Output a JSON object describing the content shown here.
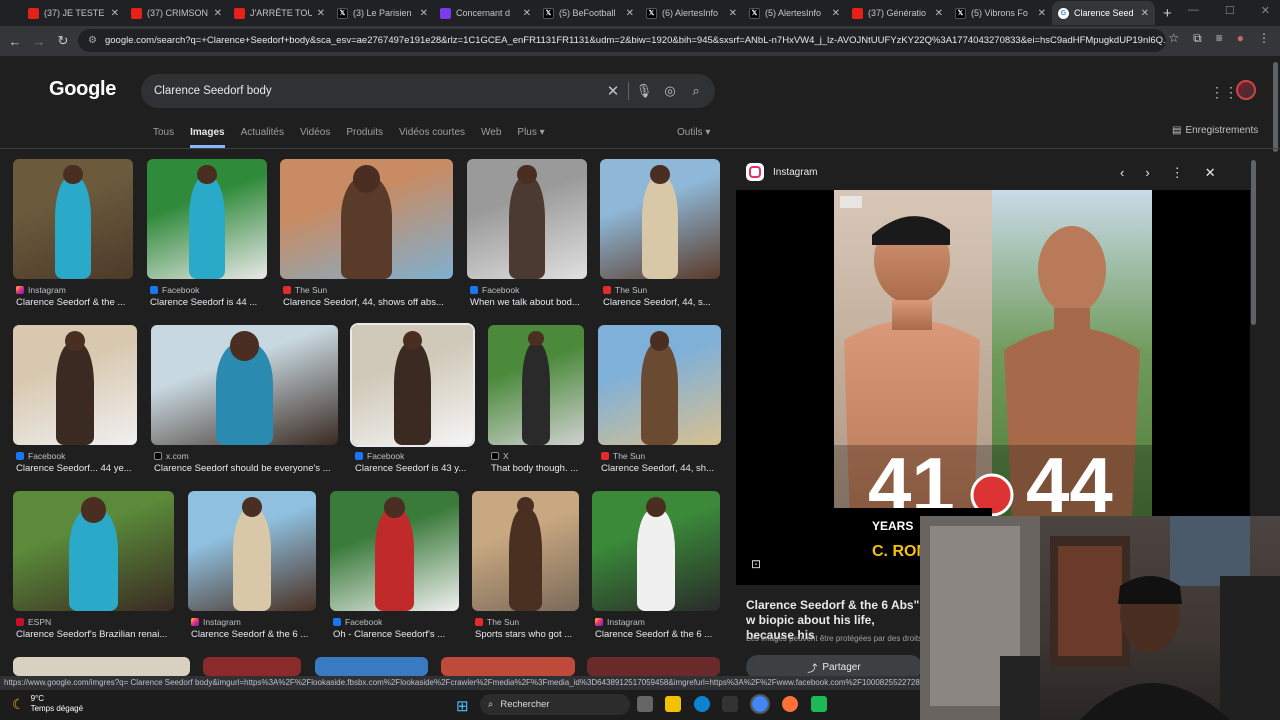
{
  "tabs": [
    {
      "label": "(37) JE TESTE L",
      "fav": "yt"
    },
    {
      "label": "(37) CRIMSON",
      "fav": "yt"
    },
    {
      "label": "J'ARRÊTE TOUT",
      "fav": "yt"
    },
    {
      "label": "(3) Le Parisien",
      "fav": "xx"
    },
    {
      "label": "Concernant d",
      "fav": "tw"
    },
    {
      "label": "(5) BeFootball",
      "fav": "xx"
    },
    {
      "label": "(6) AlertesInfo",
      "fav": "xx"
    },
    {
      "label": "(5) AlertesInfo",
      "fav": "xx"
    },
    {
      "label": "(37) Génératio",
      "fav": "yt"
    },
    {
      "label": "(5) Vibrons Fo",
      "fav": "xx"
    },
    {
      "label": "Clarence Seed",
      "fav": "gg",
      "active": true
    }
  ],
  "address": {
    "url": "google.com/search?q=+Clarence+Seedorf+body&sca_esv=ae2767497e191e28&rlz=1C1GCEA_enFR1131FR1131&udm=2&biw=1920&bih=945&sxsrf=ANbL-n7HxVW4_j_lz-AVOJNtUUFYzKY22Q%3A1774043270833&ei=hsC9adHFMpugkdUP19nl6Q..."
  },
  "google": {
    "logo": "Google",
    "query": "Clarence Seedorf body",
    "filters": [
      "Tous",
      "Images",
      "Actualités",
      "Vidéos",
      "Produits",
      "Vidéos courtes",
      "Web",
      "Plus ▾"
    ],
    "tools": "Outils ▾",
    "saved": "Enregistrements"
  },
  "results": [
    {
      "source": "Instagram",
      "src_type": "ig",
      "caption": "Clarence Seedorf & the ..."
    },
    {
      "source": "Facebook",
      "src_type": "fb",
      "caption": "Clarence Seedorf is 44 ..."
    },
    {
      "source": "The Sun",
      "src_type": "sun",
      "caption": "Clarence Seedorf, 44, shows off abs..."
    },
    {
      "source": "Facebook",
      "src_type": "fb",
      "caption": "When we talk about bod..."
    },
    {
      "source": "The Sun",
      "src_type": "sun",
      "caption": "Clarence Seedorf, 44, s..."
    },
    {
      "source": "Facebook",
      "src_type": "fb",
      "caption": "Clarence Seedorf... 44 ye..."
    },
    {
      "source": "x.com",
      "src_type": "xc",
      "caption": "Clarence Seedorf should be everyone's ..."
    },
    {
      "source": "Facebook",
      "src_type": "fb",
      "caption": "Clarence Seedorf is 43 y..."
    },
    {
      "source": "X",
      "src_type": "xc",
      "caption": "That body though. ..."
    },
    {
      "source": "The Sun",
      "src_type": "sun",
      "caption": "Clarence Seedorf, 44, sh..."
    },
    {
      "source": "ESPN",
      "src_type": "es",
      "caption": "Clarence Seedorf's Brazilian renai..."
    },
    {
      "source": "Instagram",
      "src_type": "ig",
      "caption": "Clarence Seedorf & the 6 ..."
    },
    {
      "source": "Facebook",
      "src_type": "fb",
      "caption": "Oh - Clarence Seedorf's ..."
    },
    {
      "source": "The Sun",
      "src_type": "sun",
      "caption": "Sports stars who got ..."
    },
    {
      "source": "Instagram",
      "src_type": "ig",
      "caption": "Clarence Seedorf & the 6 ..."
    }
  ],
  "preview": {
    "source": "Instagram",
    "title": "Clarence Seedorf & the 6 Abs\" w biopic about his life, because his",
    "note": "Les images peuvent être protégées par des droits",
    "share": "Partager",
    "age_left": "41",
    "age_right": "44",
    "years": "YEARS",
    "name_tag": "C. RONA"
  },
  "status_url": "https://www.google.com/imgres?q= Clarence Seedorf body&imgurl=https%3A%2F%2Flookaside.fbsbx.com%2Flookaside%2Fcrawler%2Fmedia%2F%3Fmedia_id%3D6438912517059458&imgrefurl=https%3A%2F%2Fwww.facebook.com%2F100082552272856%2F",
  "taskbar": {
    "temp": "9°C",
    "weather": "Temps dégagé",
    "search": "Rechercher"
  }
}
